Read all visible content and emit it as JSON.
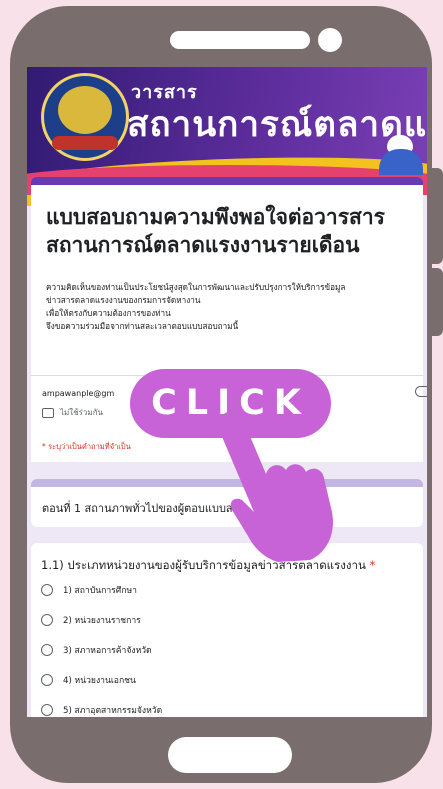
{
  "banner": {
    "small_text": "วารสาร",
    "big_text": "สถานการณ์ตลาดแรงงาน"
  },
  "form": {
    "title_line1": "แบบสอบถามความพึงพอใจต่อวารสาร",
    "title_line2": "สถานการณ์ตลาดแรงงานรายเดือน",
    "description": [
      "ความคิดเห็นของท่านเป็นประโยชน์สูงสุดในการพัฒนาและปรับปรุงการให้บริการข้อมูล",
      "ข่าวสารตลาดแรงงานของกรมการจัดหางาน",
      " เพื่อให้ตรงกับความต้องการของท่าน",
      "จึงขอความร่วมมือจากท่านสละเวลาตอบแบบสอบถามนี้"
    ]
  },
  "account": {
    "email": "ampawanple@gm",
    "share_status": "ไม่ใช้ร่วมกัน",
    "required_note": "* ระบุว่าเป็นคำถามที่จำเป็น"
  },
  "section": {
    "title": "ตอนที่ 1 สถานภาพทั่วไปของผู้ตอบแบบส"
  },
  "question": {
    "title": "1.1) ประเภทหน่วยงานของผู้รับบริการข้อมูลข่าวสารตลาดแรงงาน",
    "required_mark": "*",
    "options": [
      "1) สถาบันการศึกษา",
      "2) หน่วยงานราชการ",
      "3) สภาหอการค้าจังหวัด",
      "4) หน่วยงานเอกชน",
      "5) สภาอุตสาหกรรมจังหวัด"
    ]
  },
  "overlay": {
    "click_label": "CLICK"
  },
  "colors": {
    "background": "#f8e1e8",
    "phone": "#7a6d6d",
    "accent": "#c763d6",
    "form_purple": "#673ab7"
  }
}
